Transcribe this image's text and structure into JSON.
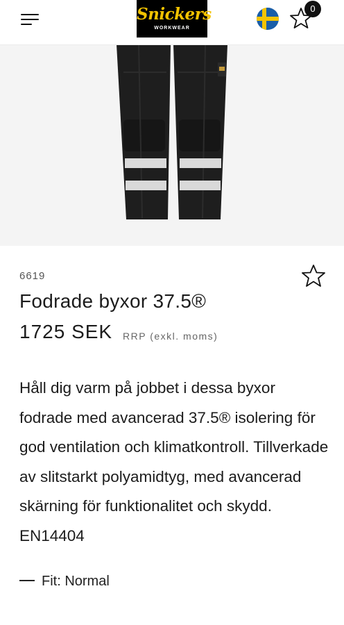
{
  "header": {
    "logo_text": "Snickers",
    "logo_subtext": "WORKWEAR",
    "favorites_count": "0",
    "flag_icon": "sweden-flag-icon",
    "menu_icon": "hamburger-menu-icon",
    "favorites_icon": "star-icon"
  },
  "product": {
    "sku": "6619",
    "title": "Fodrade byxor 37.5®",
    "price": "1725 SEK",
    "rrp_note": "RRP (exkl. moms)",
    "description": "Håll dig varm på jobbet i dessa byxor fodrade med avancerad 37.5® isolering för god ventilation och klimatkontroll. Tillverkade av slitstarkt polyamidtyg, med avancerad skärning för funktionalitet och skydd. EN14404",
    "fit_label": "Fit: Normal"
  },
  "colors": {
    "logo_yellow": "#f3c300",
    "flag_blue": "#1a5ea8",
    "flag_yellow": "#f5c400",
    "text": "#1c1c1c"
  }
}
